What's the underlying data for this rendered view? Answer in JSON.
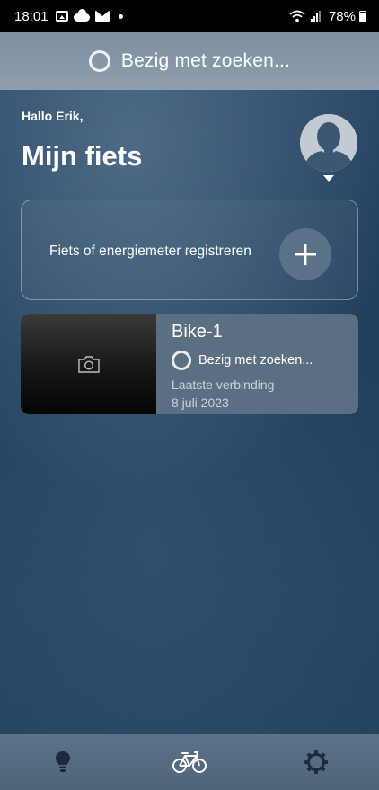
{
  "status_bar": {
    "time": "18:01",
    "battery": "78%",
    "icons": [
      "gallery-icon",
      "cloud-icon",
      "mail-icon",
      "dot-icon",
      "wifi-icon",
      "signal-icon",
      "battery-icon"
    ]
  },
  "banner": {
    "text": "Bezig met zoeken...",
    "icon": "spinner-ring-icon"
  },
  "header": {
    "greeting": "Hallo Erik,",
    "title": "Mijn fiets"
  },
  "register": {
    "label": "Fiets of energiemeter registreren",
    "icon": "plus-icon"
  },
  "bikes": [
    {
      "name": "Bike-1",
      "status": "Bezig met zoeken...",
      "last_connection_label": "Laatste verbinding",
      "last_connection_date": "8 juli 2023",
      "photo_icon": "camera-icon"
    }
  ],
  "bottom_nav": {
    "items": [
      "lightbulb-icon",
      "bicycle-icon",
      "gear-icon"
    ],
    "active": "bicycle-icon"
  },
  "colors": {
    "banner": "#8496a7",
    "card_info": "#5b6f82",
    "plus_button": "#5a7287",
    "nav": "#546b80"
  }
}
